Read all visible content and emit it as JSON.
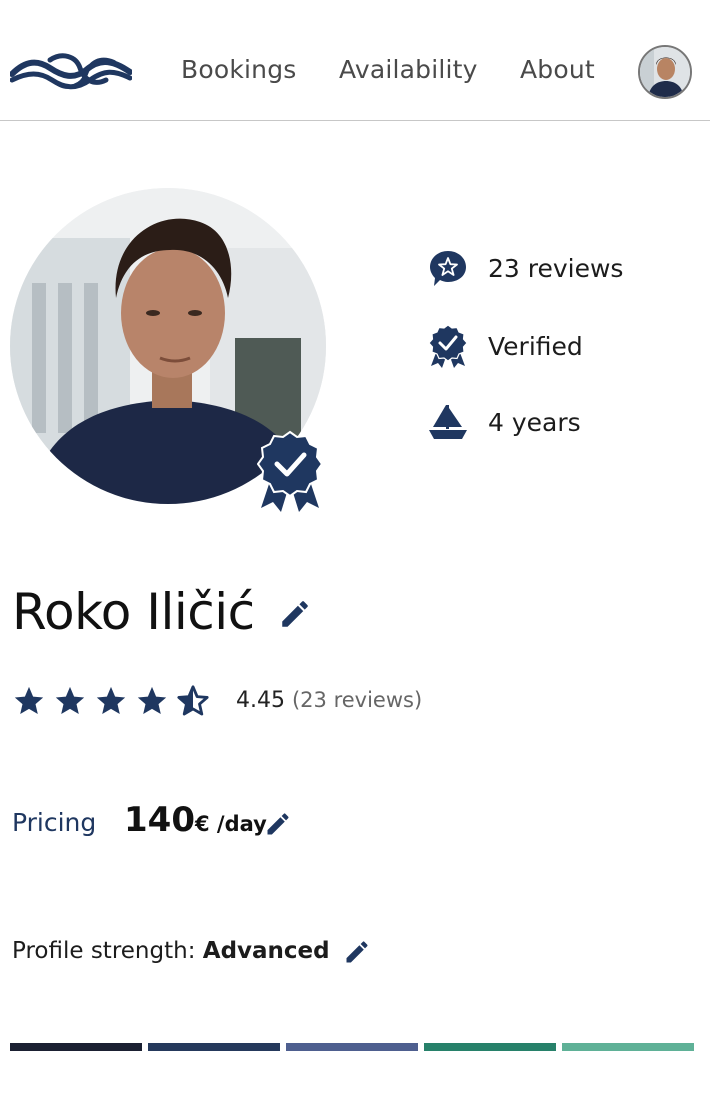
{
  "nav": {
    "links": [
      "Bookings",
      "Availability",
      "About"
    ]
  },
  "profile": {
    "name": "Roko Iličić",
    "stats": [
      {
        "icon": "star-chat-icon",
        "text": "23 reviews"
      },
      {
        "icon": "verified-badge-icon",
        "text": "Verified"
      },
      {
        "icon": "sailboat-icon",
        "text": "4 years"
      }
    ],
    "rating": {
      "stars_filled": 4.5,
      "value": "4.45",
      "count": "(23 reviews)"
    },
    "pricing": {
      "label": "Pricing",
      "amount": "140",
      "unit": "€ /day"
    },
    "strength": {
      "label": "Profile strength:",
      "value": "Advanced",
      "segment_colors": [
        "#1b2032",
        "#25395c",
        "#4e5f8f",
        "#27816a",
        "#5fb197"
      ]
    }
  },
  "colors": {
    "brand": "#1f3760",
    "text_muted": "#4a4a4a"
  }
}
